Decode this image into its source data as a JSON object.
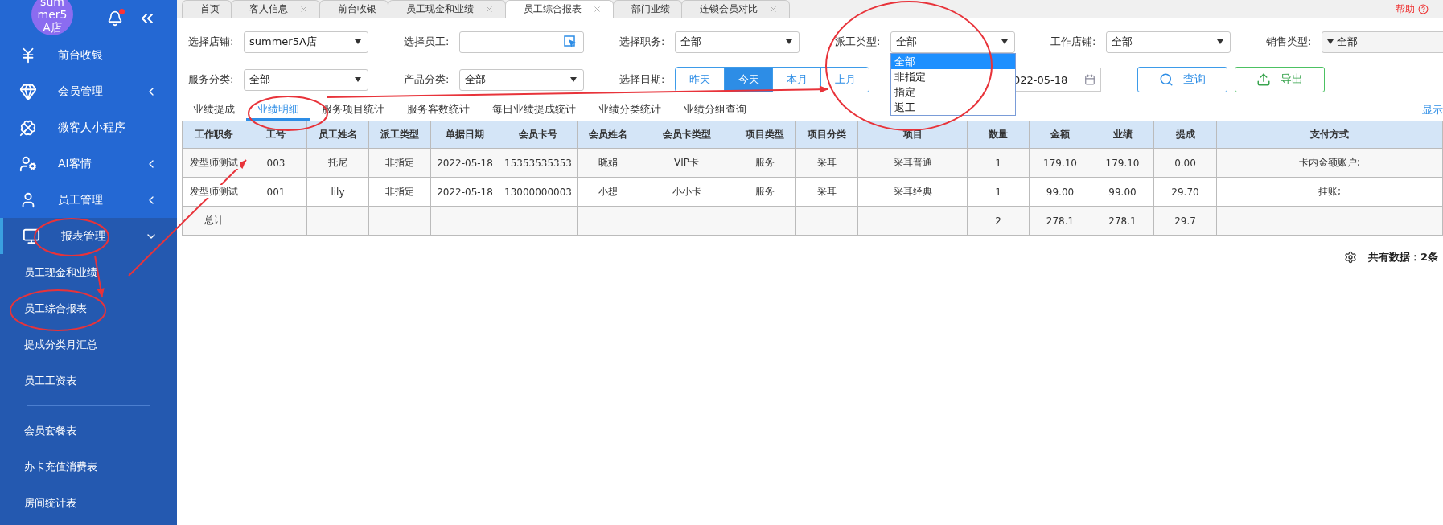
{
  "page_tabs": [
    {
      "label": "首页",
      "closable": false,
      "selected": false
    },
    {
      "label": "客人信息",
      "closable": true,
      "selected": false
    },
    {
      "label": "前台收银",
      "closable": false,
      "selected": false
    },
    {
      "label": "员工现金和业绩",
      "closable": true,
      "selected": false
    },
    {
      "label": "员工综合报表",
      "closable": true,
      "selected": true
    },
    {
      "label": "部门业绩",
      "closable": false,
      "selected": false
    },
    {
      "label": "连锁会员对比",
      "closable": true,
      "selected": false
    }
  ],
  "help": {
    "label": "帮助"
  },
  "sidebar": {
    "store": "summer5A店",
    "notification": true,
    "menu": [
      {
        "label": "前台收银",
        "kind": "link"
      },
      {
        "label": "会员管理",
        "kind": "group",
        "expanded": false
      },
      {
        "label": "微客人小程序",
        "kind": "link"
      },
      {
        "label": "AI客情",
        "kind": "group",
        "expanded": false
      },
      {
        "label": "员工管理",
        "kind": "group",
        "expanded": false
      },
      {
        "label": "报表管理",
        "kind": "group",
        "expanded": true,
        "children": [
          {
            "kind": "item",
            "label": "员工现金和业绩"
          },
          {
            "kind": "item",
            "label": "员工综合报表"
          },
          {
            "kind": "item",
            "label": "提成分类月汇总"
          },
          {
            "kind": "item",
            "label": "员工工资表"
          },
          {
            "kind": "divider"
          },
          {
            "kind": "item",
            "label": "会员套餐表"
          },
          {
            "kind": "item",
            "label": "办卡充值消费表"
          },
          {
            "kind": "item",
            "label": "房间统计表"
          }
        ]
      }
    ]
  },
  "filters": {
    "row1": [
      {
        "label": "选择店铺:",
        "kind": "select",
        "value": "summer5A店"
      },
      {
        "label": "选择员工:",
        "kind": "picker"
      },
      {
        "label": "选择职务:",
        "kind": "select",
        "value": "全部"
      },
      {
        "label": "派工类型:",
        "kind": "select",
        "value": "全部",
        "open": true,
        "options": [
          {
            "label": "全部",
            "selected": true
          },
          {
            "label": "非指定",
            "selected": false
          },
          {
            "label": "指定",
            "selected": false
          },
          {
            "label": "返工",
            "selected": false
          }
        ]
      },
      {
        "label": "工作店铺:",
        "kind": "select",
        "value": "全部"
      },
      {
        "label": "销售类型:",
        "kind": "multiselect",
        "value": "全部"
      }
    ],
    "row2": [
      {
        "label": "服务分类:",
        "kind": "select",
        "value": "全部"
      },
      {
        "label": "产品分类:",
        "kind": "select",
        "value": "全部"
      }
    ],
    "date": {
      "label": "选择日期:",
      "ranges": [
        {
          "label": "昨天",
          "selected": false
        },
        {
          "label": "今天",
          "selected": true
        },
        {
          "label": "本月",
          "selected": false
        },
        {
          "label": "上月",
          "selected": false
        }
      ],
      "value": "022-05-18"
    },
    "buttons": [
      {
        "label": "查询",
        "kind": "search"
      },
      {
        "label": "导出",
        "kind": "export"
      }
    ]
  },
  "report_tabs": [
    {
      "label": "业绩提成",
      "selected": false
    },
    {
      "label": "业绩明细",
      "selected": true
    },
    {
      "label": "服务项目统计",
      "selected": false
    },
    {
      "label": "服务客数统计",
      "selected": false
    },
    {
      "label": "每日业绩提成统计",
      "selected": false
    },
    {
      "label": "业绩分类统计",
      "selected": false
    },
    {
      "label": "业绩分组查询",
      "selected": false
    }
  ],
  "display_settings": "显示",
  "table": {
    "columns": [
      "工作职务",
      "工号",
      "员工姓名",
      "派工类型",
      "单据日期",
      "会员卡号",
      "会员姓名",
      "会员卡类型",
      "项目类型",
      "项目分类",
      "项目",
      "数量",
      "金额",
      "业绩",
      "提成",
      "支付方式"
    ],
    "rows": [
      [
        "发型师测试",
        "003",
        "托尼",
        "非指定",
        "2022-05-18",
        "15353535353",
        "晓娟",
        "VIP卡",
        "服务",
        "采耳",
        "采耳普通",
        "1",
        "179.10",
        "179.10",
        "0.00",
        "卡内金额账户;"
      ],
      [
        "发型师测试",
        "001",
        "lily",
        "非指定",
        "2022-05-18",
        "13000000003",
        "小想",
        "小小卡",
        "服务",
        "采耳",
        "采耳经典",
        "1",
        "99.00",
        "99.00",
        "29.70",
        "挂账;"
      ]
    ],
    "total": {
      "label": "总计",
      "quantity": "2",
      "amount": "278.1",
      "performance": "278.1",
      "commission": "29.7"
    }
  },
  "footer": {
    "count": "共有数据：2条"
  }
}
